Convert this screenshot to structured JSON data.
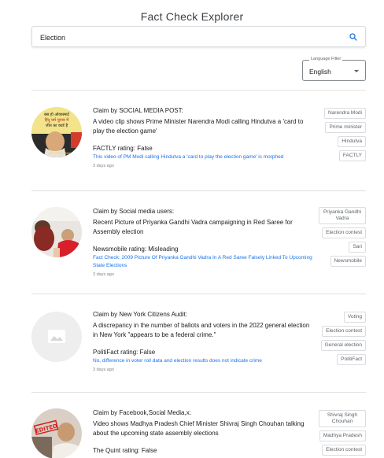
{
  "app": {
    "title": "Fact Check Explorer"
  },
  "search": {
    "value": "Election",
    "placeholder": "",
    "icon": "search-icon"
  },
  "language_filter": {
    "label": "Language Filter",
    "value": "English"
  },
  "results": [
    {
      "claimant": "Claim by SOCIAL MEDIA POST:",
      "claim": "A video clip shows Prime Minister Narendra Modi calling Hindutva a 'card to play the election game'",
      "publisher": "FACTLY",
      "rating_word": " rating: ",
      "rating": "False",
      "review_title": "This video of PM Modi calling Hindutva a 'card to play the election game' is morphed",
      "date": "3 days ago",
      "tags": [
        "Narendra Modi",
        "Prime minister",
        "Hindutva",
        "FACTLY"
      ]
    },
    {
      "claimant": "Claim by Social media users:",
      "claim": "Recent Picture of Priyanka Gandhi Vadra campaigning in Red Saree for Assembly election",
      "publisher": "Newsmobile",
      "rating_word": " rating: ",
      "rating": "Misleading",
      "review_title": "Fact Check: 2009 Picture Of Priyanka Gandhi Vadra In A Red Saree Falsely Linked To Upcoming State Elections",
      "date": "3 days ago",
      "tags": [
        "Priyanka Gandhi Vadra",
        "Election contest",
        "Sari",
        "Newsmobile"
      ]
    },
    {
      "claimant": "Claim by New York Citizens Audit:",
      "claim": "A discrepancy in the number of ballots and voters in the 2022 general election in New York \"appears to be a federal crime.\"",
      "publisher": "PolitiFact",
      "rating_word": " rating: ",
      "rating": "False",
      "review_title": "No, difference in voter roll data and election results does not indicate crime",
      "date": "3 days ago",
      "tags": [
        "Voting",
        "Election contest",
        "General election",
        "PolitiFact"
      ]
    },
    {
      "claimant": "Claim by Facebook,Social Media,x:",
      "claim": "Video shows Madhya Pradesh Chief Minister Shivraj Singh Chouhan talking about the upcoming state assembly elections",
      "publisher": "The Quint",
      "rating_word": " rating: ",
      "rating": "False",
      "review_title": "",
      "date": "",
      "tags": [
        "Shivraj Singh Chouhan",
        "Madhya Pradesh",
        "Election contest"
      ]
    }
  ],
  "thumb_overlay": {
    "r1_line1": "बस हो ओवरस्मार्ट",
    "r1_line2": "हिंदू धर्म चुनाव में",
    "r1_line3": "जीत का कार्ड है",
    "r1_line4": "हमारे असम के निवासा",
    "r4_stamp": "EDITED"
  },
  "colors": {
    "accent": "#1a73e8",
    "border": "#dadce0",
    "placeholder_thumb": "#eeeeee"
  }
}
